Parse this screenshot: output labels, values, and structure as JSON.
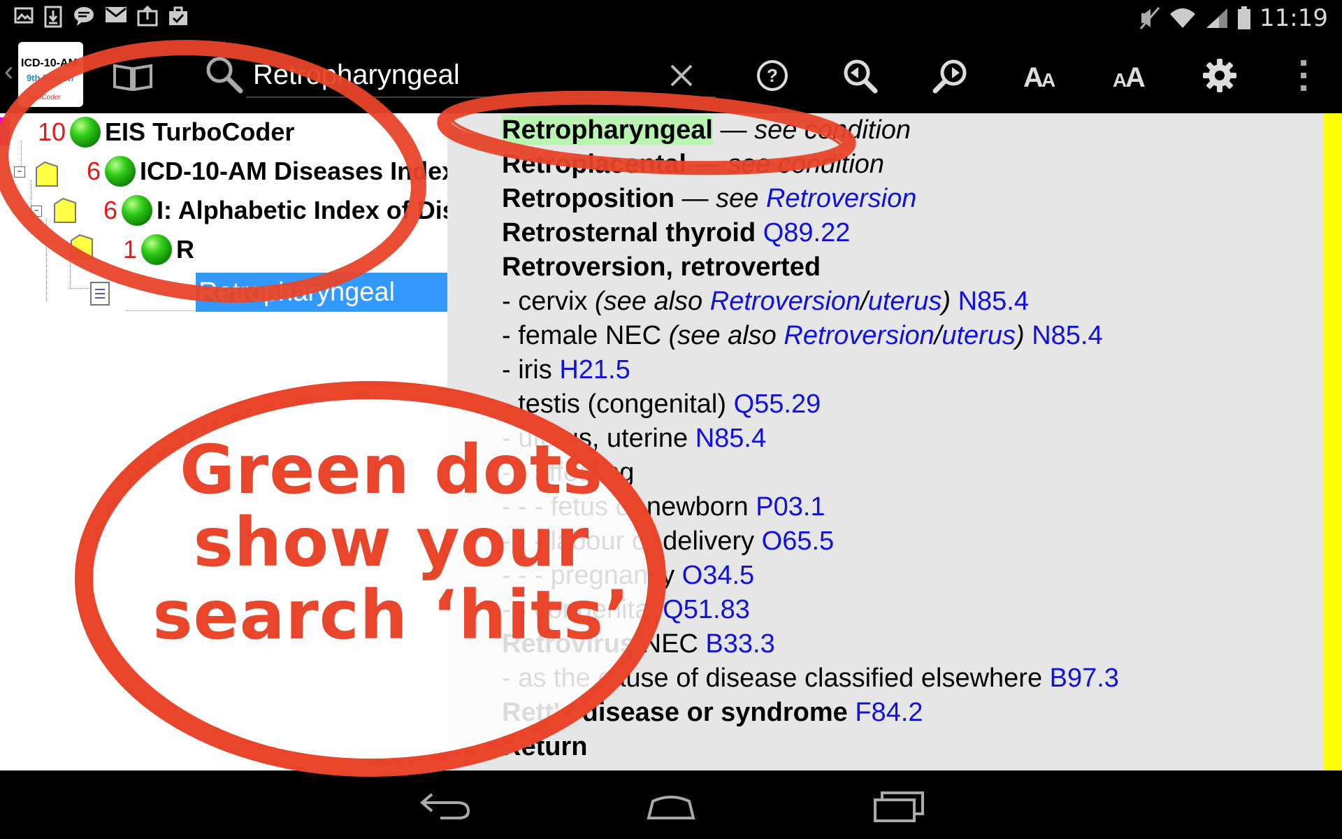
{
  "status_bar": {
    "notification_icons": [
      "image-icon",
      "download-icon",
      "chat-icon",
      "mail-icon",
      "briefcase-upload-icon",
      "clipboard-check-icon"
    ],
    "system_icons": [
      "mute-icon",
      "wifi-icon",
      "signal-icon",
      "battery-icon"
    ],
    "time": "11:19"
  },
  "action_bar": {
    "logo": {
      "line1": "ICD-10-AM",
      "line2": "9th Edition",
      "line3": "TurboCoder"
    },
    "search_value": "Retropharyngeal",
    "icons": [
      "clear-icon",
      "help-icon",
      "zoom-out-icon",
      "zoom-in-icon",
      "text-smaller-icon",
      "text-larger-icon",
      "settings-icon",
      "overflow-menu-icon"
    ]
  },
  "tree": {
    "nodes": [
      {
        "count": "10",
        "label": "EIS TurboCoder"
      },
      {
        "count": "6",
        "label": "ICD-10-AM Diseases Index"
      },
      {
        "count": "6",
        "label": "I: Alphabetic Index of Diseases"
      },
      {
        "count": "1",
        "label": "R"
      }
    ],
    "selected_item": "Retropharyngeal"
  },
  "content": {
    "entries": [
      {
        "segments": [
          {
            "t": "Retropharyngeal",
            "s": "bh"
          },
          {
            "t": " — ",
            "s": "n"
          },
          {
            "t": "see condition",
            "s": "i"
          }
        ]
      },
      {
        "segments": [
          {
            "t": "Retroplacental",
            "s": "b"
          },
          {
            "t": " — ",
            "s": "n"
          },
          {
            "t": "see condition",
            "s": "i"
          }
        ]
      },
      {
        "segments": [
          {
            "t": "Retroposition",
            "s": "b"
          },
          {
            "t": " — ",
            "s": "n"
          },
          {
            "t": "see ",
            "s": "i"
          },
          {
            "t": "Retroversion",
            "s": "ic"
          }
        ]
      },
      {
        "segments": [
          {
            "t": "Retrosternal thyroid",
            "s": "b"
          },
          {
            "t": " ",
            "s": "n"
          },
          {
            "t": "Q89.22",
            "s": "c"
          }
        ]
      },
      {
        "segments": [
          {
            "t": "Retroversion, retroverted",
            "s": "b"
          }
        ]
      },
      {
        "segments": [
          {
            "t": "-  cervix ",
            "s": "n"
          },
          {
            "t": "(see also ",
            "s": "i"
          },
          {
            "t": "Retroversion",
            "s": "ic"
          },
          {
            "t": "/",
            "s": "i"
          },
          {
            "t": "uterus",
            "s": "ic"
          },
          {
            "t": ") ",
            "s": "i"
          },
          {
            "t": "N85.4",
            "s": "c"
          }
        ]
      },
      {
        "segments": [
          {
            "t": "-  female NEC ",
            "s": "n"
          },
          {
            "t": "(see also ",
            "s": "i"
          },
          {
            "t": "Retroversion",
            "s": "ic"
          },
          {
            "t": "/",
            "s": "i"
          },
          {
            "t": "uterus",
            "s": "ic"
          },
          {
            "t": ") ",
            "s": "i"
          },
          {
            "t": "N85.4",
            "s": "c"
          }
        ]
      },
      {
        "segments": [
          {
            "t": "-  iris ",
            "s": "n"
          },
          {
            "t": "H21.5",
            "s": "c"
          }
        ]
      },
      {
        "segments": [
          {
            "t": "-  testis (congenital) ",
            "s": "n"
          },
          {
            "t": "Q55.29",
            "s": "c"
          }
        ]
      },
      {
        "segments": [
          {
            "t": "-  uterus, uterine ",
            "s": "n"
          },
          {
            "t": "N85.4",
            "s": "c"
          }
        ]
      },
      {
        "segments": [
          {
            "t": "-  -  affecting",
            "s": "n"
          }
        ]
      },
      {
        "segments": [
          {
            "t": "-  -  -  fetus or newborn ",
            "s": "n"
          },
          {
            "t": "P03.1",
            "s": "c"
          }
        ]
      },
      {
        "segments": [
          {
            "t": "-  -  -  labour or delivery ",
            "s": "n"
          },
          {
            "t": "O65.5",
            "s": "c"
          }
        ]
      },
      {
        "segments": [
          {
            "t": "-  -  -  pregnancy ",
            "s": "n"
          },
          {
            "t": "O34.5",
            "s": "c"
          }
        ]
      },
      {
        "segments": [
          {
            "t": "-  -  congenital ",
            "s": "n"
          },
          {
            "t": "Q51.83",
            "s": "c"
          }
        ]
      },
      {
        "segments": [
          {
            "t": "Retrovirus",
            "s": "b"
          },
          {
            "t": " NEC ",
            "s": "n"
          },
          {
            "t": "B33.3",
            "s": "c"
          }
        ]
      },
      {
        "segments": [
          {
            "t": "-  as the cause of disease classified elsewhere ",
            "s": "n"
          },
          {
            "t": "B97.3",
            "s": "c"
          }
        ]
      },
      {
        "segments": [
          {
            "t": "Rett's disease or syndrome",
            "s": "b"
          },
          {
            "t": " ",
            "s": "n"
          },
          {
            "t": "F84.2",
            "s": "c"
          }
        ]
      },
      {
        "segments": [
          {
            "t": "Return",
            "s": "b"
          }
        ]
      }
    ]
  },
  "overlay": {
    "callout_lines": [
      "Green dots",
      "show your",
      "search ‘hits’"
    ],
    "callout_color": "#e8452a"
  },
  "nav_bar": {
    "icons": [
      "back-icon",
      "home-icon",
      "recent-apps-icon"
    ]
  }
}
